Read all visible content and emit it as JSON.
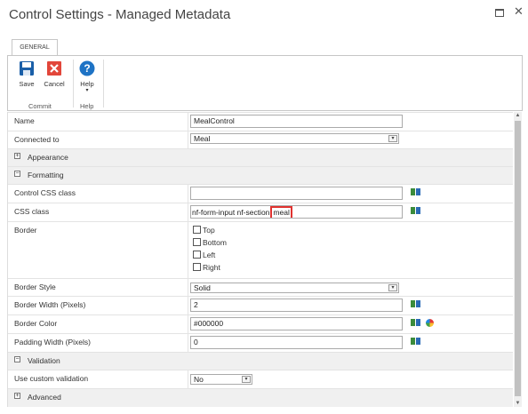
{
  "window": {
    "title": "Control Settings - Managed Metadata",
    "maximize_icon": "maximize-icon",
    "close_glyph": "✕"
  },
  "ribbon": {
    "tab": "GENERAL",
    "buttons": {
      "save": "Save",
      "cancel": "Cancel",
      "help": "Help",
      "help_caret": "▾"
    },
    "groups": {
      "commit": "Commit",
      "help": "Help"
    }
  },
  "form": {
    "name": {
      "label": "Name",
      "value": "MealControl"
    },
    "connected_to": {
      "label": "Connected to",
      "value": "Meal"
    },
    "appearance": {
      "label": "Appearance",
      "toggle": "+"
    },
    "formatting": {
      "label": "Formatting",
      "toggle": "−"
    },
    "control_css": {
      "label": "Control CSS class",
      "value": ""
    },
    "css_class": {
      "label": "CSS class",
      "value_prefix": "nf-form-input nf-section",
      "value_highlight": "meal"
    },
    "border": {
      "label": "Border",
      "options": [
        "Top",
        "Bottom",
        "Left",
        "Right"
      ]
    },
    "border_style": {
      "label": "Border Style",
      "value": "Solid"
    },
    "border_width": {
      "label": "Border Width (Pixels)",
      "value": "2"
    },
    "border_color": {
      "label": "Border Color",
      "value": "#000000"
    },
    "padding_width": {
      "label": "Padding Width (Pixels)",
      "value": "0"
    },
    "validation": {
      "label": "Validation",
      "toggle": "−"
    },
    "custom_validation": {
      "label": "Use custom validation",
      "value": "No"
    },
    "advanced": {
      "label": "Advanced",
      "toggle": "+"
    }
  },
  "colors": {
    "highlight": "#e0322f",
    "save_icon": "#1a5fa8",
    "cancel_icon": "#e2463a",
    "help_icon": "#1e73c5"
  }
}
